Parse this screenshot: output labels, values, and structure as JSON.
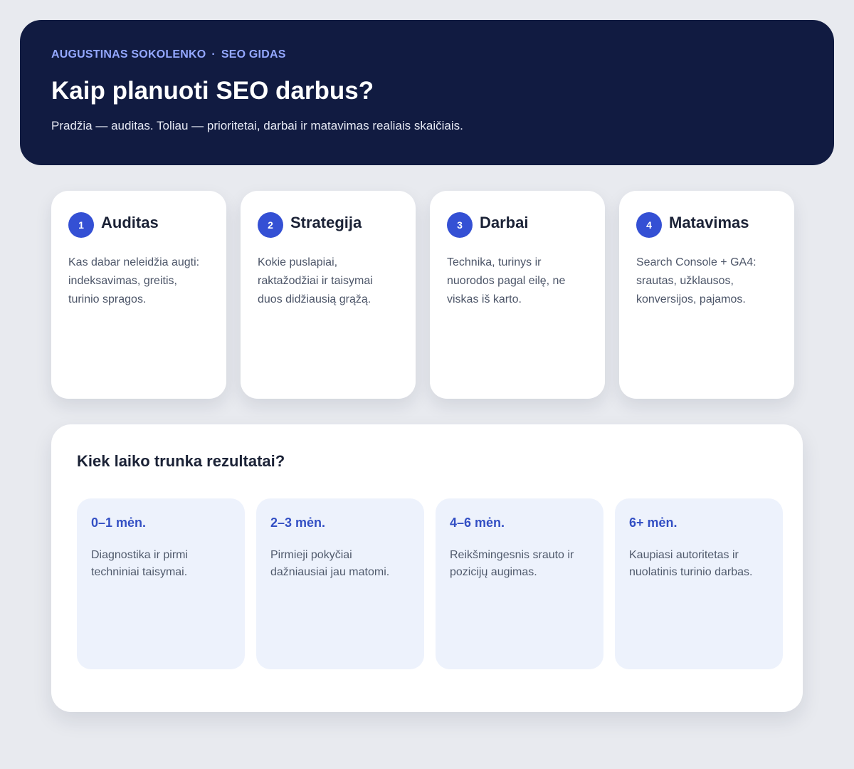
{
  "header": {
    "author": "AUGUSTINAS SOKOLENKO",
    "separator": "·",
    "section": "SEO GIDAS",
    "title": "Kaip planuoti SEO darbus?",
    "subtitle": "Pradžia — auditas. Toliau — prioritetai, darbai ir matavimas realiais skaičiais."
  },
  "steps": [
    {
      "number": "1",
      "title": "Auditas",
      "description": "Kas dabar neleidžia augti: indeksavimas, greitis, turinio spragos."
    },
    {
      "number": "2",
      "title": "Strategija",
      "description": "Kokie puslapiai, raktažodžiai ir taisymai duos didžiausią grąžą."
    },
    {
      "number": "3",
      "title": "Darbai",
      "description": "Technika, turinys ir nuorodos pagal eilę, ne viskas iš karto."
    },
    {
      "number": "4",
      "title": "Matavimas",
      "description": "Search Console + GA4: srautas, užklausos, konversijos, pajamos."
    }
  ],
  "timeline": {
    "title": "Kiek laiko trunka rezultatai?",
    "phases": [
      {
        "period": "0–1 mėn.",
        "description": "Diagnostika ir pirmi techniniai taisymai."
      },
      {
        "period": "2–3 mėn.",
        "description": "Pirmieji pokyčiai dažniausiai jau matomi."
      },
      {
        "period": "4–6 mėn.",
        "description": "Reikšmingesnis srauto ir pozicijų augimas."
      },
      {
        "period": "6+ mėn.",
        "description": "Kaupiasi autoritetas ir nuolatinis turinio darbas."
      }
    ]
  },
  "colors": {
    "page_background": "#e8eaef",
    "hero_background": "#111b41",
    "kicker_text": "#94a8ff",
    "accent": "#3450d4",
    "phase_background": "#edf2fc",
    "heading_text": "#1b2236"
  }
}
